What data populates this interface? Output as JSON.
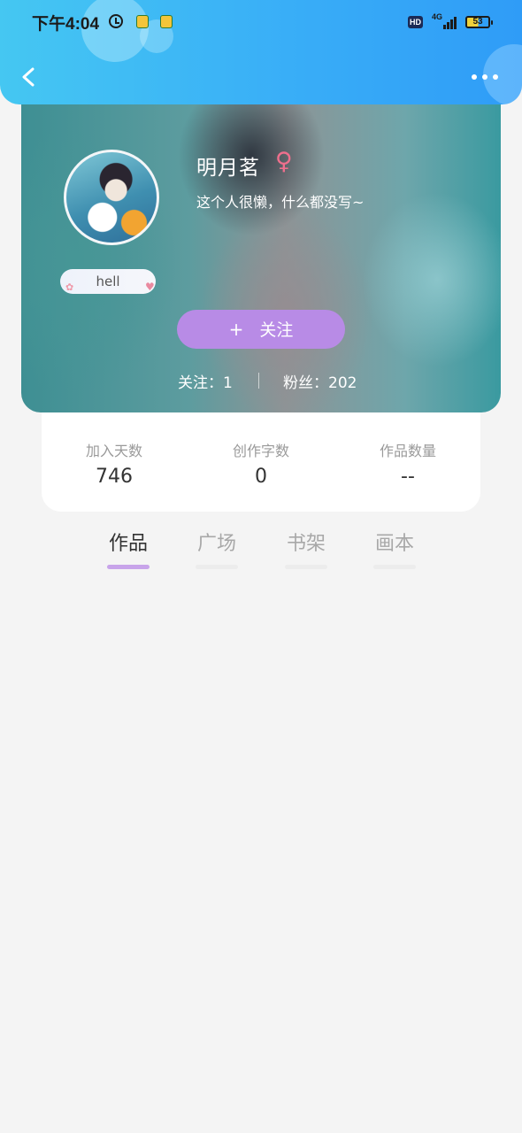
{
  "status_bar": {
    "time": "下午4:04",
    "hd_label": "HD",
    "network_label": "4G",
    "battery_level": "53"
  },
  "profile": {
    "username": "明月茗",
    "gender_symbol": "♀",
    "bio": "这个人很懒，什么都没写~",
    "tag": "hell",
    "follow_button_plus": "+",
    "follow_button_label": "关注",
    "following_text": "关注：1",
    "fans_text": "粉丝：202"
  },
  "stats": [
    {
      "label": "加入天数",
      "value": "746"
    },
    {
      "label": "创作字数",
      "value": "0"
    },
    {
      "label": "作品数量",
      "value": "--"
    }
  ],
  "tabs": [
    {
      "label": "作品",
      "active": true
    },
    {
      "label": "广场",
      "active": false
    },
    {
      "label": "书架",
      "active": false
    },
    {
      "label": "画本",
      "active": false
    }
  ],
  "colors": {
    "header_blue": "#39aef7",
    "follow_button": "#b88be6",
    "active_tab_underline": "#c8a4ea",
    "female_icon": "#ef6f8d"
  }
}
